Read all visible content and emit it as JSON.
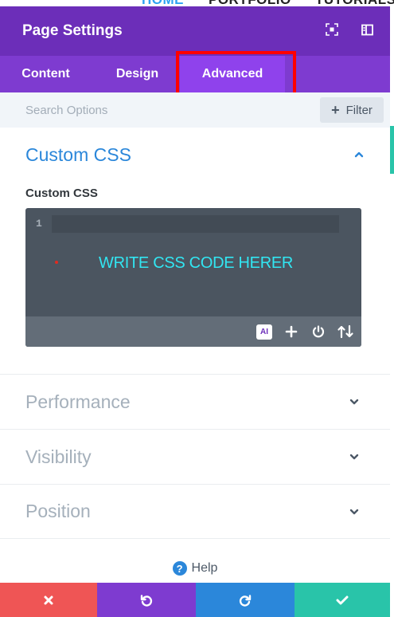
{
  "background_site": {
    "nav": [
      "HOME",
      "PORTFOLIO",
      "TUTORIALS"
    ]
  },
  "modal": {
    "title": "Page Settings",
    "header_icons": [
      "fullscreen-icon",
      "sidebar-split-icon"
    ]
  },
  "tabs": [
    {
      "label": "Content",
      "active": false
    },
    {
      "label": "Design",
      "active": false
    },
    {
      "label": "Advanced",
      "active": true
    }
  ],
  "search": {
    "placeholder": "Search Options",
    "filter_label": "Filter"
  },
  "custom_css": {
    "section_title": "Custom CSS",
    "field_label": "Custom CSS",
    "line_number": "1",
    "annotation_text": "WRITE CSS CODE HERER",
    "toolbar_icons": [
      "ai-icon",
      "plus-icon",
      "power-icon",
      "sort-icon"
    ],
    "ai_label": "AI"
  },
  "sections": [
    {
      "title": "Performance",
      "expanded": false
    },
    {
      "title": "Visibility",
      "expanded": false
    },
    {
      "title": "Position",
      "expanded": false
    }
  ],
  "help": {
    "label": "Help",
    "icon_glyph": "?"
  },
  "footer": {
    "buttons": [
      "cancel",
      "undo",
      "redo",
      "save"
    ]
  },
  "colors": {
    "header_purple": "#6c2eb9",
    "tab_purple": "#7e3bd0",
    "active_tab": "#8f42ec",
    "accent_blue": "#2b87da",
    "cancel_red": "#ef5555",
    "save_green": "#29c4a9",
    "annotation_cyan": "#31e6f2",
    "highlight_red": "#ff0000"
  }
}
